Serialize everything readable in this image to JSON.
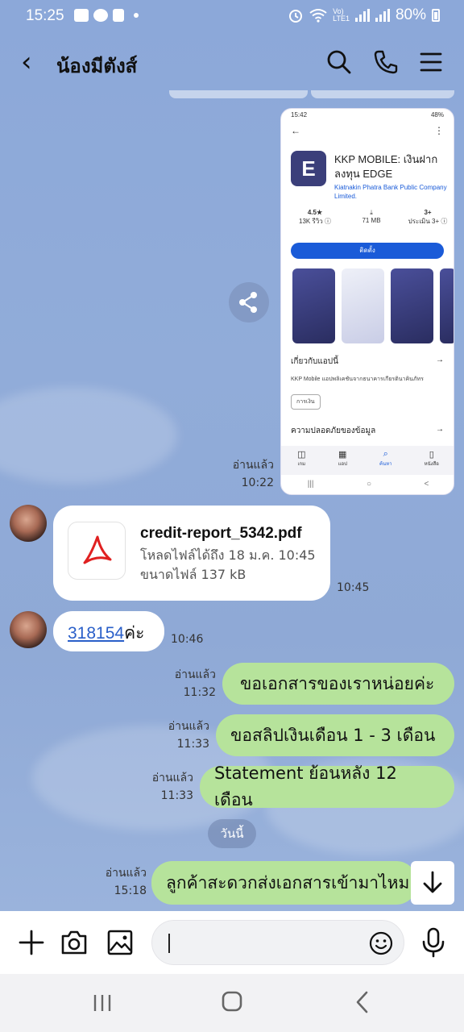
{
  "status_bar": {
    "time": "15:25",
    "battery": "80%",
    "icons": [
      "gallery-icon",
      "line-icon",
      "play-icon",
      "dot-icon",
      "alarm-icon",
      "wifi-icon",
      "volte-icon",
      "signal-icon",
      "signal-icon",
      "battery-icon"
    ]
  },
  "header": {
    "title": "น้องมีตังส์",
    "icons": [
      "back-icon",
      "search-icon",
      "call-icon",
      "menu-icon"
    ]
  },
  "screenshot_message": {
    "phone_status_time": "15:42",
    "phone_battery": "48%",
    "app_name": "KKP MOBILE: เงินฝาก ลงทุน EDGE",
    "developer": "Kiatnakin Phatra Bank Public Company Limited.",
    "rating": "4.5★",
    "reviews": "13K รีวิว ⓘ",
    "size": "71 MB",
    "age_rating": "3+",
    "age_label": "ประเมิน 3+ ⓘ",
    "install_label": "ติดตั้ง",
    "about_title": "เกี่ยวกับแอปนี้",
    "about_desc": "KKP Mobile แอปพลิเคชันจากธนาคารเกียรตินาคินภัทร",
    "chip": "การเงิน",
    "safety_title": "ความปลอดภัยของข้อมูล",
    "nav_items": [
      "เกม",
      "แอป",
      "ค้นหา",
      "หนังสือ"
    ],
    "read": "อ่านแล้ว",
    "time": "10:22"
  },
  "file_message": {
    "file_name": "credit-report_5342.pdf",
    "download_until": "โหลดไฟล์ได้ถึง 18 ม.ค. 10:45",
    "file_size": "ขนาดไฟล์ 137 kB",
    "time": "10:45"
  },
  "code_message": {
    "number": "318154",
    "suffix": "ค่ะ",
    "time": "10:46"
  },
  "outgoing": [
    {
      "text": "ขอเอกสารของเราหน่อยค่ะ",
      "read": "อ่านแล้ว",
      "time": "11:32"
    },
    {
      "text": "ขอสลิปเงินเดือน 1 - 3 เดือน",
      "read": "อ่านแล้ว",
      "time": "11:33"
    },
    {
      "text": "Statement ย้อนหลัง 12 เดือน",
      "read": "อ่านแล้ว",
      "time": "11:33"
    },
    {
      "text": "ลูกค้าสะดวกส่งเอกสารเข้ามาไหม",
      "read": "อ่านแล้ว",
      "time": "15:18"
    }
  ],
  "day_divider": "วันนี้",
  "input": {
    "placeholder": ""
  }
}
